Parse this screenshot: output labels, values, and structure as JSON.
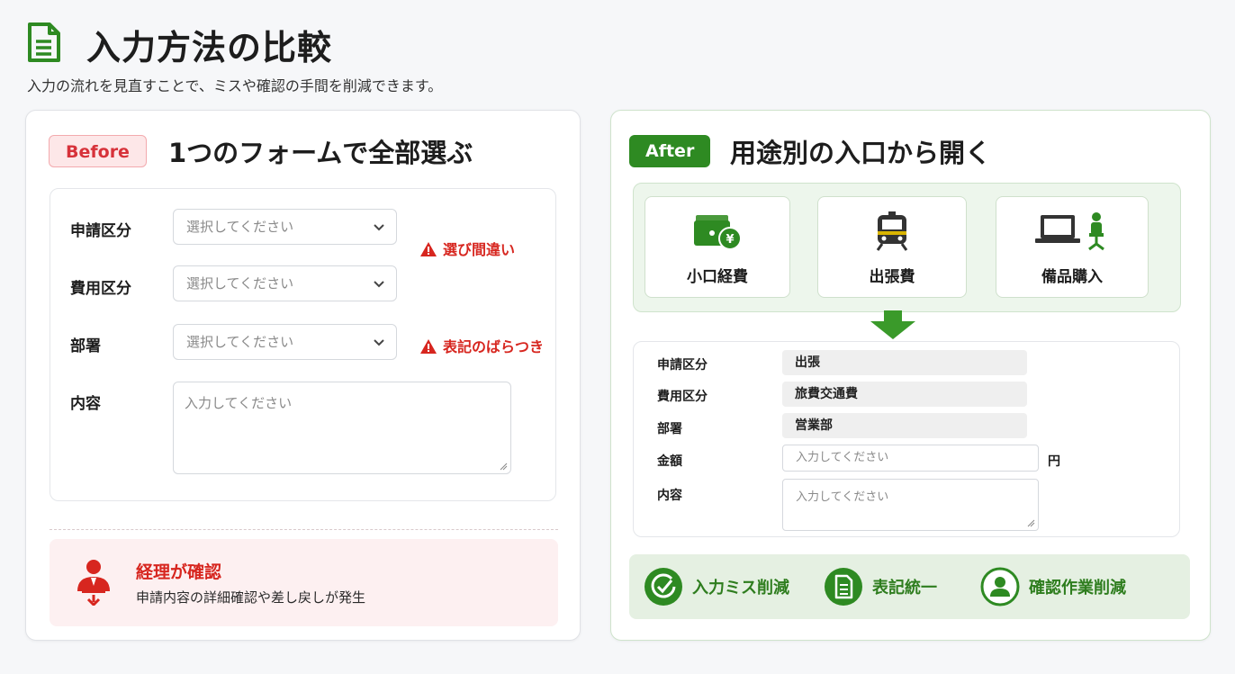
{
  "header": {
    "title": "入力方法の比較",
    "subtitle": "入力の流れを見直すことで、ミスや確認の手間を削減できます。"
  },
  "before": {
    "badge": "Before",
    "heading": "1つのフォームで全部選ぶ",
    "fields": [
      {
        "label": "申請区分",
        "placeholder": "選択してください"
      },
      {
        "label": "費用区分",
        "placeholder": "選択してください"
      },
      {
        "label": "部署",
        "placeholder": "選択してください"
      },
      {
        "label": "内容",
        "placeholder": "入力してください"
      }
    ],
    "warnings": [
      "選び間違い",
      "表記のばらつき"
    ],
    "alert": {
      "title": "経理が確認",
      "description": "申請内容の詳細確認や差し戻しが発生"
    }
  },
  "after": {
    "badge": "After",
    "heading": "用途別の入口から開く",
    "categories": [
      {
        "label": "小口経費",
        "icon": "wallet-yen-icon"
      },
      {
        "label": "出張費",
        "icon": "train-icon"
      },
      {
        "label": "備品購入",
        "icon": "laptop-chair-icon"
      }
    ],
    "fields": [
      {
        "label": "申請区分",
        "value": "出張"
      },
      {
        "label": "費用区分",
        "value": "旅費交通費"
      },
      {
        "label": "部署",
        "value": "営業部"
      },
      {
        "label": "金額",
        "placeholder": "入力してください",
        "unit": "円"
      },
      {
        "label": "内容",
        "placeholder": "入力してください"
      }
    ],
    "benefits": [
      {
        "label": "入力ミス削減",
        "icon": "check-circle-icon"
      },
      {
        "label": "表記統一",
        "icon": "document-icon"
      },
      {
        "label": "確認作業削減",
        "icon": "user-icon"
      }
    ]
  },
  "colors": {
    "accent_green": "#2e8a22",
    "warning_red": "#d7261f"
  }
}
